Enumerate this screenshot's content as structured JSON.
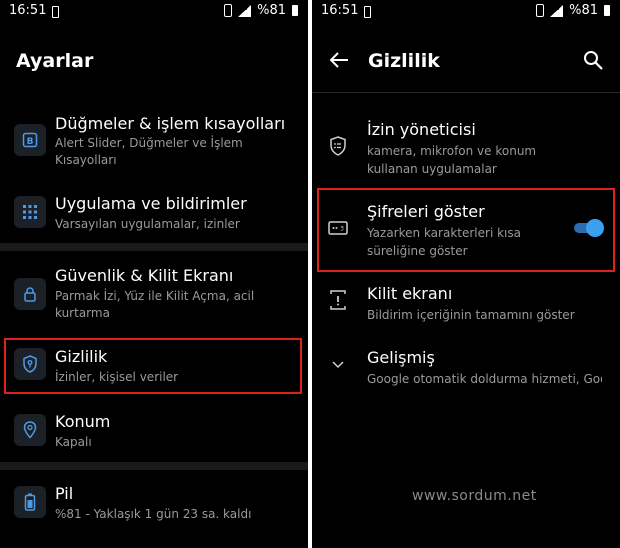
{
  "left": {
    "status": {
      "time": "16:51",
      "battery": "%81",
      "signal": "4G"
    },
    "title": "Ayarlar",
    "items": [
      {
        "title": "Düğmeler & işlem kısayolları",
        "sub": "Alert Slider, Düğmeler ve İşlem Kısayolları",
        "icon": "b-button-icon"
      },
      {
        "title": "Uygulama ve bildirimler",
        "sub": "Varsayılan uygulamalar, izinler",
        "icon": "apps-grid-icon"
      },
      {
        "title": "Güvenlik & Kilit Ekranı",
        "sub": "Parmak İzi, Yüz ile Kilit Açma, acil kurtarma",
        "icon": "lock-icon"
      },
      {
        "title": "Gizlilik",
        "sub": "İzinler, kişisel veriler",
        "icon": "privacy-shield-icon"
      },
      {
        "title": "Konum",
        "sub": "Kapalı",
        "icon": "location-icon"
      },
      {
        "title": "Pil",
        "sub": "%81 - Yaklaşık 1 gün 23 sa. kaldı",
        "icon": "battery-icon"
      }
    ]
  },
  "right": {
    "status": {
      "time": "16:51",
      "battery": "%81",
      "signal": "4G"
    },
    "title": "Gizlilik",
    "items": [
      {
        "title": "İzin yöneticisi",
        "sub": "kamera, mikrofon ve konum kullanan uygulamalar",
        "icon": "permission-manager-icon"
      },
      {
        "title": "Şifreleri göster",
        "sub": "Yazarken karakterleri kısa süreliğine göster",
        "icon": "password-dots-icon",
        "toggle": true
      },
      {
        "title": "Kilit ekranı",
        "sub": "Bildirim içeriğinin tamamını göster",
        "icon": "lock-screen-icon"
      },
      {
        "title": "Gelişmiş",
        "sub": "Google otomatik doldurma hizmeti, Goo...",
        "icon": "chevron-down-icon"
      }
    ]
  },
  "watermark": "www.sordum.net",
  "colors": {
    "highlight": "#e0201b",
    "toggle_on": "#3aa0f0",
    "background": "#000000"
  }
}
